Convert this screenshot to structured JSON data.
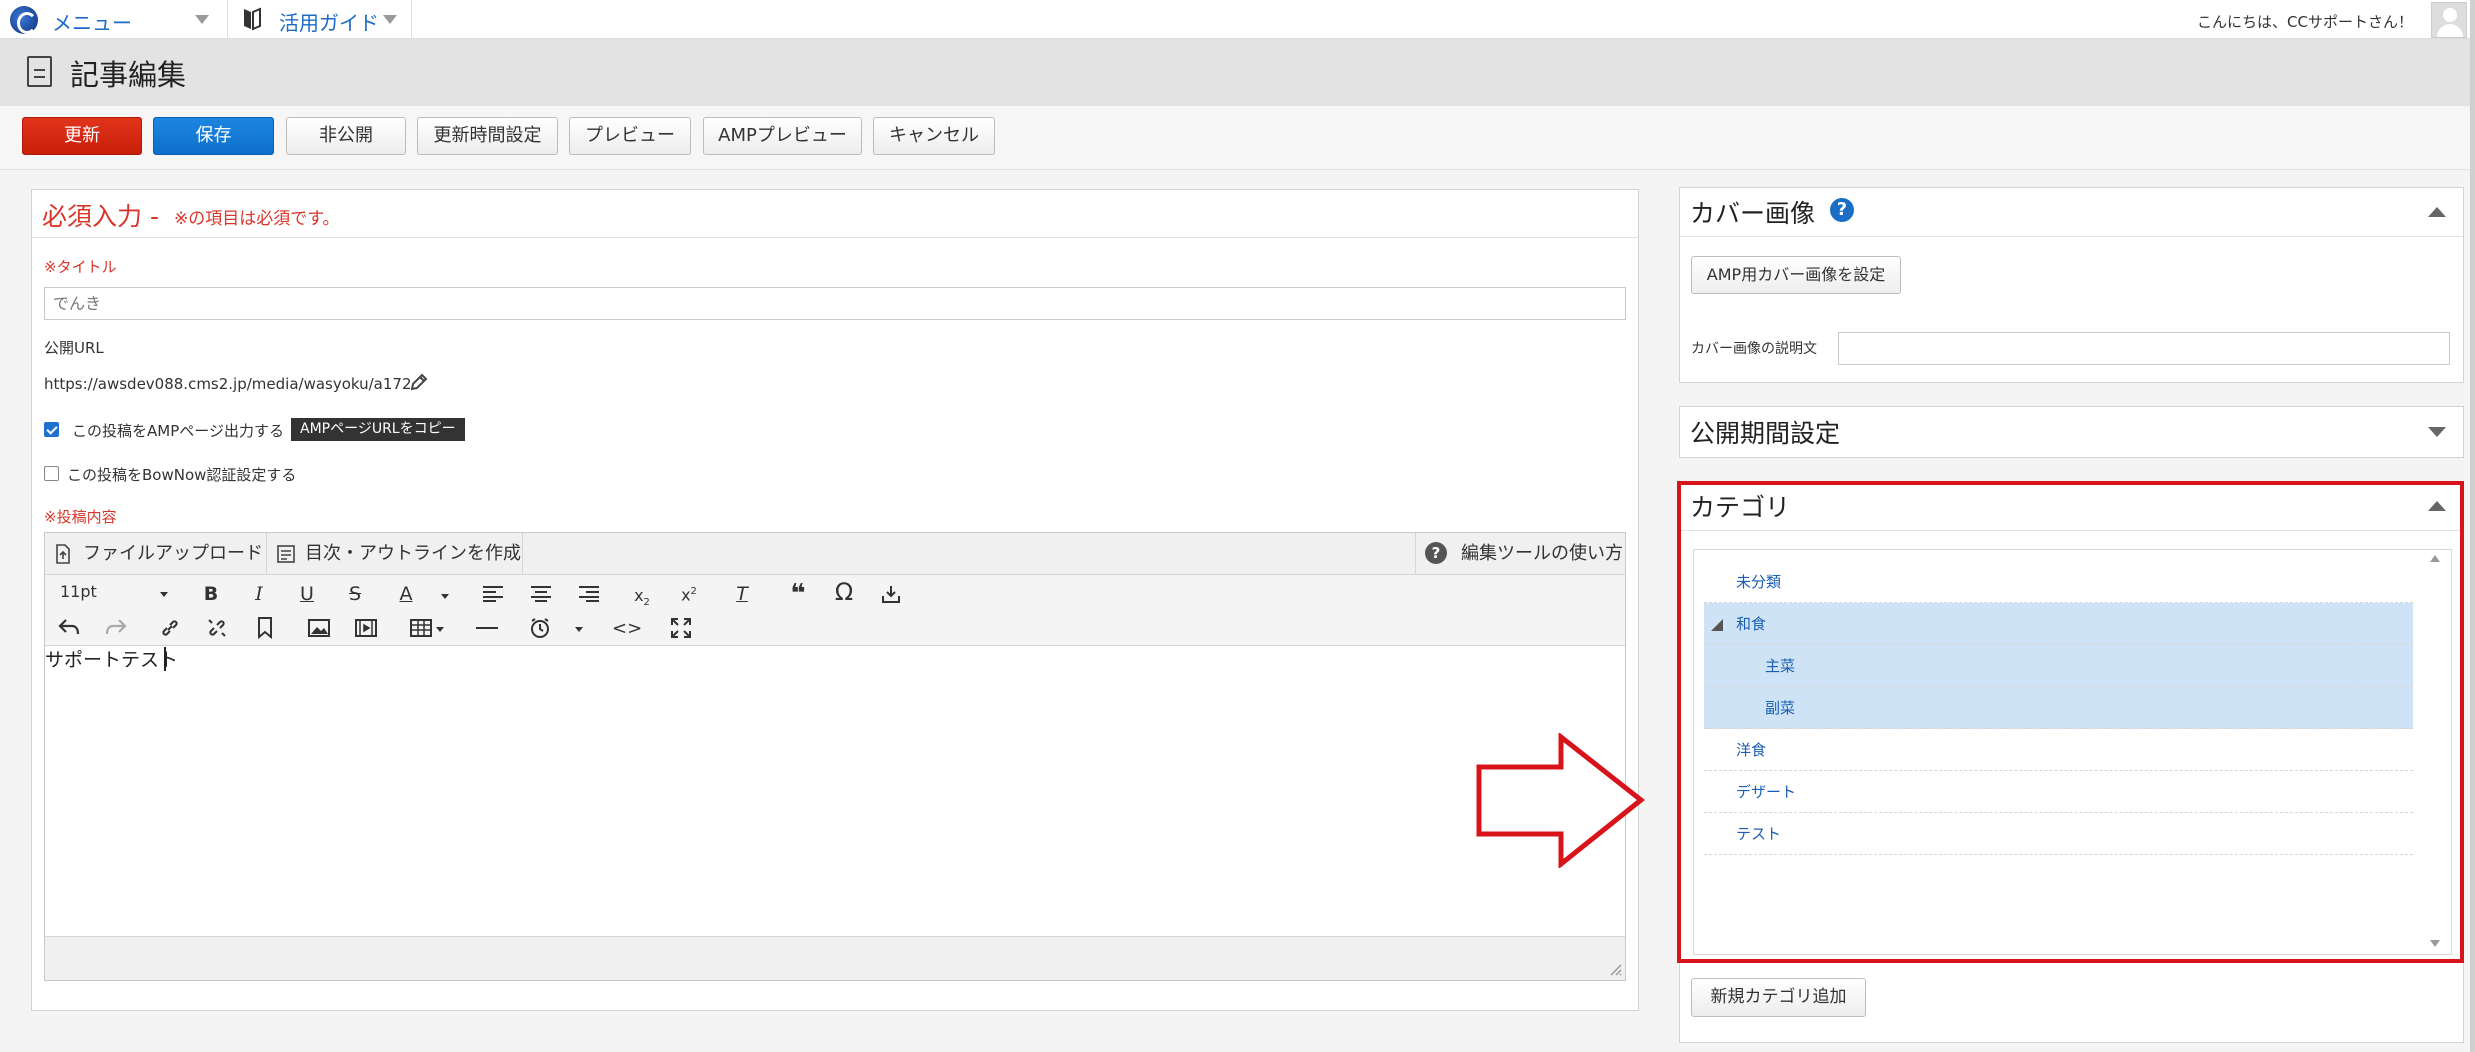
{
  "topnav": {
    "menu_label": "メニュー",
    "guide_label": "活用ガイド",
    "greeting": "こんにちは、CCサポートさん！"
  },
  "page": {
    "title": "記事編集"
  },
  "toolbar": {
    "update": "更新",
    "save": "保存",
    "unpublish": "非公開",
    "update_time": "更新時間設定",
    "preview": "プレビュー",
    "amp_preview": "AMPプレビュー",
    "cancel": "キャンセル"
  },
  "required": {
    "heading": "必須入力 -",
    "note": "※の項目は必須です。",
    "title_label": "※タイトル",
    "title_value": "でんき",
    "url_label": "公開URL",
    "url_value": "https://awsdev088.cms2.jp/media/wasyoku/a172",
    "amp_checkbox_label": "この投稿をAMPページ出力する",
    "amp_copy_button": "AMPページURLをコピー",
    "bownow_checkbox_label": "この投稿をBowNow認証設定する",
    "content_label": "※投稿内容"
  },
  "editor": {
    "tab_upload": "ファイルアップロード",
    "tab_outline": "目次・アウトラインを作成",
    "help": "編集ツールの使い方",
    "font_size": "11pt",
    "body_text": "サポートテスト"
  },
  "cover": {
    "title": "カバー画像",
    "amp_button": "AMP用カバー画像を設定",
    "desc_label": "カバー画像の説明文"
  },
  "period": {
    "title": "公開期間設定"
  },
  "category": {
    "title": "カテゴリ",
    "items": [
      {
        "label": "未分類",
        "selected": false
      },
      {
        "label": "和食",
        "selected": true
      },
      {
        "label": "主菜",
        "selected": true
      },
      {
        "label": "副菜",
        "selected": true
      },
      {
        "label": "洋食",
        "selected": false
      },
      {
        "label": "デザート",
        "selected": false
      },
      {
        "label": "テスト",
        "selected": false
      }
    ],
    "add_button": "新規カテゴリ追加"
  },
  "colors": {
    "accent_red": "#d8141b",
    "save_blue": "#0e6fcb",
    "update_red": "#c81f0a",
    "selected_row": "#cfe3f6"
  }
}
